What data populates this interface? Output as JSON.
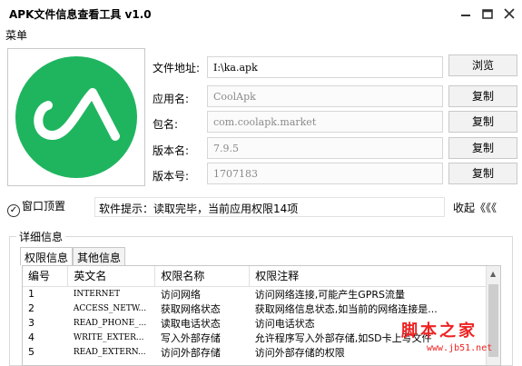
{
  "window": {
    "title": "APK文件信息查看工具 v1.0",
    "controls": {
      "minimize": "minimize-icon",
      "maximize": "maximize-icon",
      "close": "close-icon"
    }
  },
  "menu": {
    "label": "菜单"
  },
  "logo": {
    "icon": "coolapk-logo-icon",
    "bg_color": "#1fb55f"
  },
  "fields": [
    {
      "label": "文件地址:",
      "value": "I:\\ka.apk",
      "button": "浏览"
    },
    {
      "label": "应用名:",
      "value": "CoolApk",
      "button": "复制"
    },
    {
      "label": "包名:",
      "value": "com.coolapk.market",
      "button": "复制"
    },
    {
      "label": "版本名:",
      "value": "7.9.5",
      "button": "复制"
    },
    {
      "label": "版本号:",
      "value": "1707183",
      "button": "复制"
    }
  ],
  "topmost": {
    "label": "窗口顶置",
    "checked": true
  },
  "tip": {
    "text": "软件提示：读取完毕，当前应用权限14项"
  },
  "collapse": {
    "label": "收起《《《"
  },
  "details": {
    "title": "详细信息",
    "tabs": [
      "权限信息",
      "其他信息"
    ],
    "columns": [
      "编号",
      "英文名",
      "权限名称",
      "权限注释"
    ],
    "rows": [
      [
        "1",
        "INTERNET",
        "访问网络",
        "访问网络连接,可能产生GPRS流量"
      ],
      [
        "2",
        "ACCESS_NETW...",
        "获取网络状态",
        "获取网络信息状态,如当前的网络连接是..."
      ],
      [
        "3",
        "READ_PHONE_...",
        "读取电话状态",
        "访问电话状态"
      ],
      [
        "4",
        "WRITE_EXTER...",
        "写入外部存储",
        "允许程序写入外部存储,如SD卡上写文件"
      ],
      [
        "5",
        "READ_EXTERN...",
        "访问外部存储",
        "访问外部存储的权限"
      ]
    ]
  },
  "watermark": {
    "text": "脚本之家",
    "url": "www.jb51.net"
  }
}
